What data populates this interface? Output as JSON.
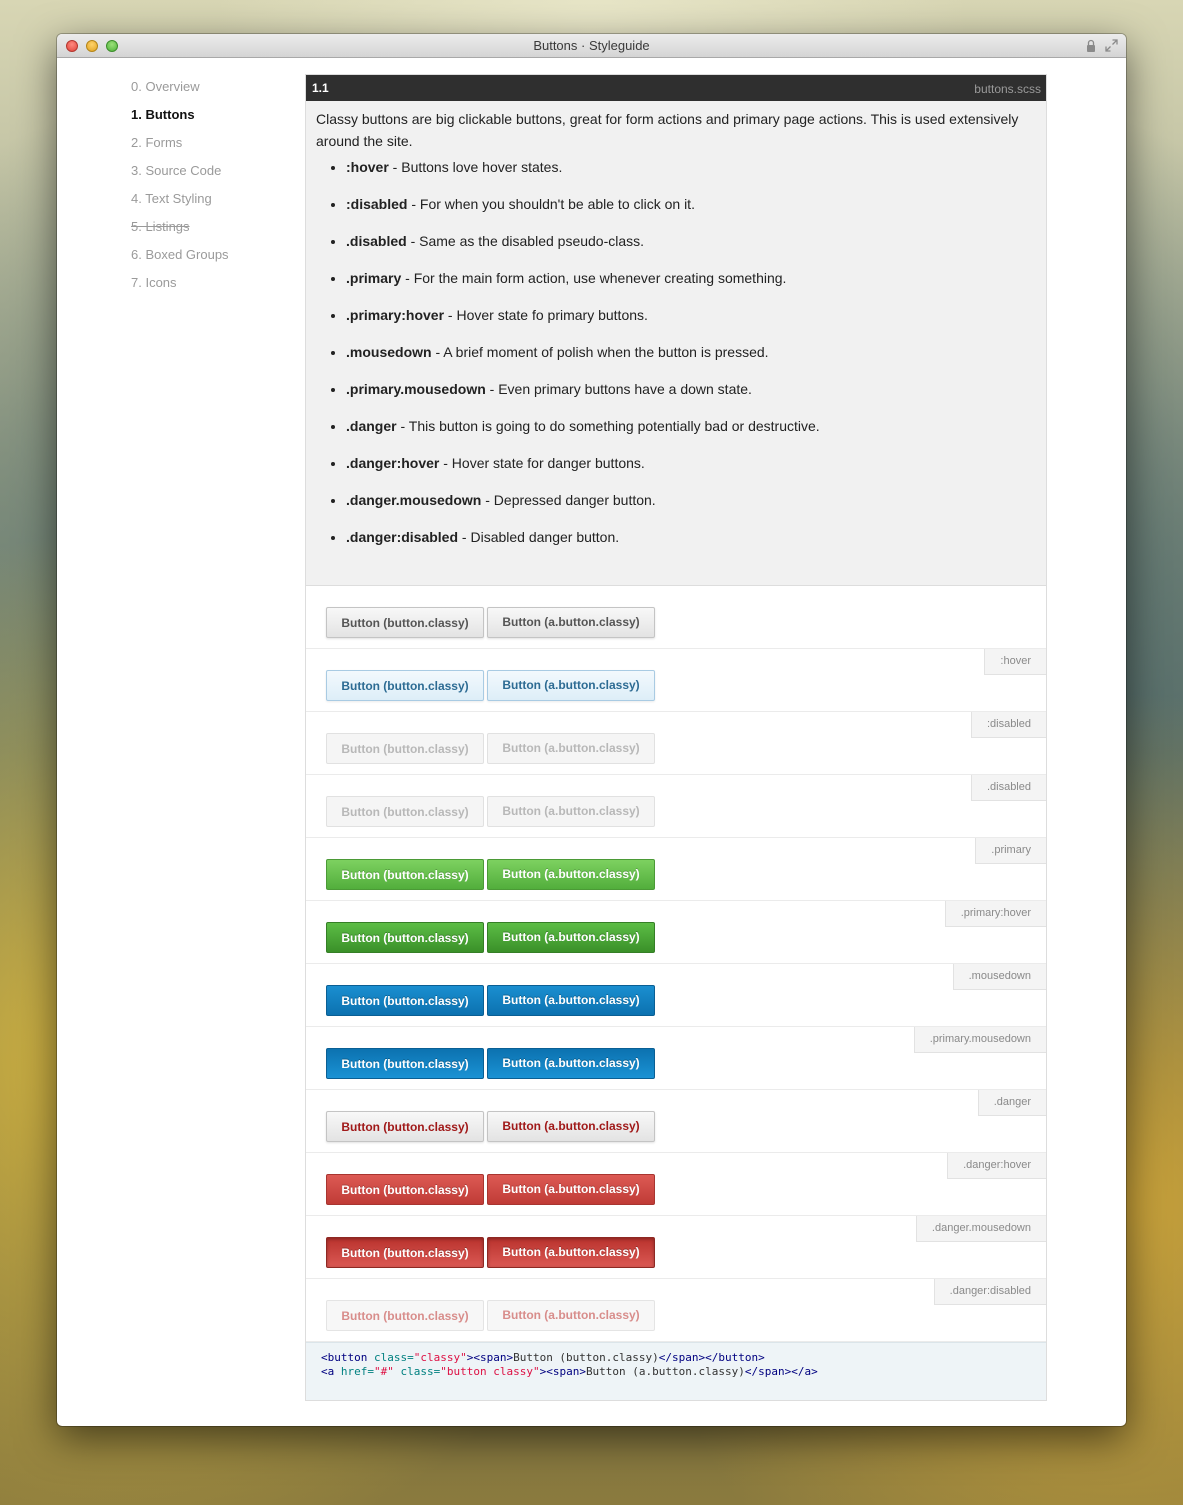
{
  "window": {
    "title": "Buttons · Styleguide"
  },
  "nav": [
    {
      "label": "0. Overview",
      "active": false,
      "struck": false
    },
    {
      "label": "1. Buttons",
      "active": true,
      "struck": false
    },
    {
      "label": "2. Forms",
      "active": false,
      "struck": false
    },
    {
      "label": "3. Source Code",
      "active": false,
      "struck": false
    },
    {
      "label": "4. Text Styling",
      "active": false,
      "struck": false
    },
    {
      "label": "5. Listings",
      "active": false,
      "struck": true
    },
    {
      "label": "6. Boxed Groups",
      "active": false,
      "struck": false
    },
    {
      "label": "7. Icons",
      "active": false,
      "struck": false
    }
  ],
  "section": {
    "number": "1.1",
    "file": "buttons.scss",
    "description": "Classy buttons are big clickable buttons, great for form actions and primary page actions. This is used extensively around the site.",
    "modifiers": [
      {
        "name": ":hover",
        "desc": " - Buttons love hover states."
      },
      {
        "name": ":disabled",
        "desc": " - For when you shouldn't be able to click on it."
      },
      {
        "name": ".disabled",
        "desc": " - Same as the disabled pseudo-class."
      },
      {
        "name": ".primary",
        "desc": " - For the main form action, use whenever creating something."
      },
      {
        "name": ".primary:hover",
        "desc": " - Hover state fo primary buttons."
      },
      {
        "name": ".mousedown",
        "desc": " - A brief moment of polish when the button is pressed."
      },
      {
        "name": ".primary.mousedown",
        "desc": " - Even primary buttons have a down state."
      },
      {
        "name": ".danger",
        "desc": " - This button is going to do something potentially bad or destructive."
      },
      {
        "name": ".danger:hover",
        "desc": " - Hover state for danger buttons."
      },
      {
        "name": ".danger.mousedown",
        "desc": " - Depressed danger button."
      },
      {
        "name": ".danger:disabled",
        "desc": " - Disabled danger button."
      }
    ],
    "examples": [
      {
        "tag": "",
        "style": "s-default"
      },
      {
        "tag": ":hover",
        "style": "s-hover"
      },
      {
        "tag": ":disabled",
        "style": "s-disabled"
      },
      {
        "tag": ".disabled",
        "style": "s-disabled"
      },
      {
        "tag": ".primary",
        "style": "s-primary"
      },
      {
        "tag": ".primary:hover",
        "style": "s-primary-hover"
      },
      {
        "tag": ".mousedown",
        "style": "s-mousedown"
      },
      {
        "tag": ".primary.mousedown",
        "style": "s-primary-mousedown"
      },
      {
        "tag": ".danger",
        "style": "s-danger"
      },
      {
        "tag": ".danger:hover",
        "style": "s-danger-hover"
      },
      {
        "tag": ".danger.mousedown",
        "style": "s-danger-mousedown"
      },
      {
        "tag": ".danger:disabled",
        "style": "s-danger-disabled"
      }
    ],
    "button_label_1": "Button (button.classy)",
    "button_label_2": "Button (a.button.classy)",
    "code_lines": [
      [
        [
          "tag",
          "<button "
        ],
        [
          "attr",
          "class="
        ],
        [
          "str",
          "\"classy\""
        ],
        [
          "tag",
          "><span>"
        ],
        [
          "txt",
          "Button (button.classy)"
        ],
        [
          "tag",
          "</span></button>"
        ]
      ],
      [
        [
          "tag",
          "<a "
        ],
        [
          "attr",
          "href="
        ],
        [
          "str",
          "\"#\""
        ],
        [
          "attr",
          " class="
        ],
        [
          "str",
          "\"button classy\""
        ],
        [
          "tag",
          "><span>"
        ],
        [
          "txt",
          "Button (a.button.classy)"
        ],
        [
          "tag",
          "</span></a>"
        ]
      ]
    ]
  }
}
